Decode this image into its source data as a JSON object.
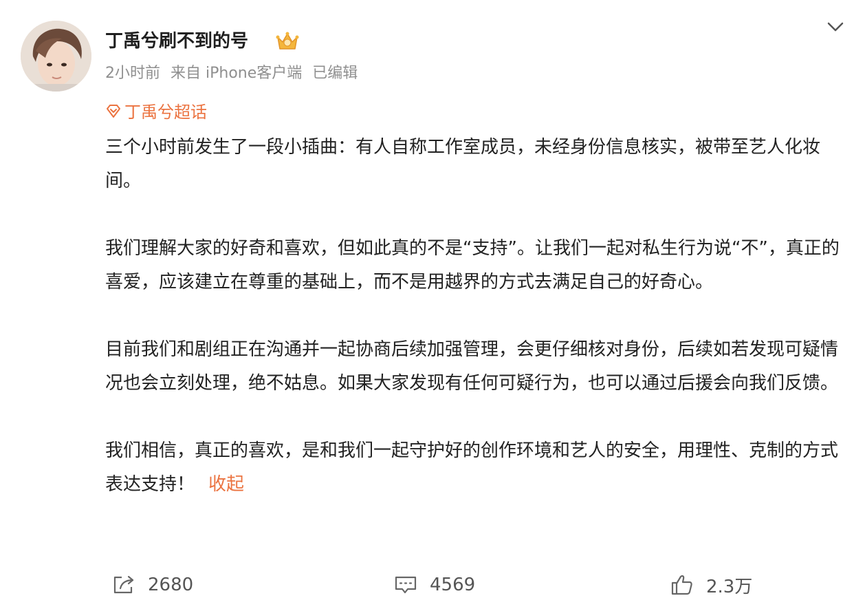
{
  "author": {
    "name": "丁禹兮刷不到的号",
    "badge_icon": "crown-badge-icon"
  },
  "meta": {
    "time": "2小时前",
    "source": "来自 iPhone客户端",
    "edited": "已编辑"
  },
  "topic": {
    "icon": "super-topic-diamond-icon",
    "label": "丁禹兮超话"
  },
  "post": {
    "paragraphs": [
      "三个小时前发生了一段小插曲：有人自称工作室成员，未经身份信息核实，被带至艺人化妆间。",
      "我们理解大家的好奇和喜欢，但如此真的不是“支持”。让我们一起对私生行为说“不”，真正的喜爱，应该建立在尊重的基础上，而不是用越界的方式去满足自己的好奇心。",
      "目前我们和剧组正在沟通并一起协商后续加强管理，会更仔细核对身份，后续如若发现可疑情况也会立刻处理，绝不姑息。如果大家发现有任何可疑行为，也可以通过后援会向我们反馈。",
      "我们相信，真正的喜欢，是和我们一起守护好的创作环境和艺人的安全，用理性、克制的方式表达支持！"
    ],
    "collapse_label": "收起"
  },
  "actions": {
    "share": {
      "icon": "share-icon",
      "count": "2680"
    },
    "comment": {
      "icon": "comment-icon",
      "count": "4569"
    },
    "like": {
      "icon": "thumbs-up-icon",
      "count": "2.3万"
    }
  },
  "colors": {
    "accent": "#eb7340",
    "meta_gray": "#8f8f8f",
    "text": "#222222"
  }
}
